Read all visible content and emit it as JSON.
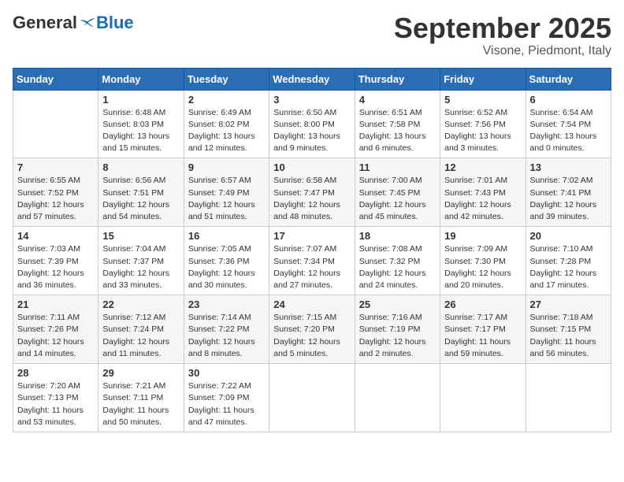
{
  "header": {
    "logo": {
      "general": "General",
      "blue": "Blue"
    },
    "title": "September 2025",
    "location": "Visone, Piedmont, Italy"
  },
  "calendar": {
    "weekdays": [
      "Sunday",
      "Monday",
      "Tuesday",
      "Wednesday",
      "Thursday",
      "Friday",
      "Saturday"
    ],
    "weeks": [
      [
        null,
        {
          "day": 1,
          "sunrise": "6:48 AM",
          "sunset": "8:03 PM",
          "daylight": "13 hours and 15 minutes."
        },
        {
          "day": 2,
          "sunrise": "6:49 AM",
          "sunset": "8:02 PM",
          "daylight": "13 hours and 12 minutes."
        },
        {
          "day": 3,
          "sunrise": "6:50 AM",
          "sunset": "8:00 PM",
          "daylight": "13 hours and 9 minutes."
        },
        {
          "day": 4,
          "sunrise": "6:51 AM",
          "sunset": "7:58 PM",
          "daylight": "13 hours and 6 minutes."
        },
        {
          "day": 5,
          "sunrise": "6:52 AM",
          "sunset": "7:56 PM",
          "daylight": "13 hours and 3 minutes."
        },
        {
          "day": 6,
          "sunrise": "6:54 AM",
          "sunset": "7:54 PM",
          "daylight": "13 hours and 0 minutes."
        }
      ],
      [
        {
          "day": 7,
          "sunrise": "6:55 AM",
          "sunset": "7:52 PM",
          "daylight": "12 hours and 57 minutes."
        },
        {
          "day": 8,
          "sunrise": "6:56 AM",
          "sunset": "7:51 PM",
          "daylight": "12 hours and 54 minutes."
        },
        {
          "day": 9,
          "sunrise": "6:57 AM",
          "sunset": "7:49 PM",
          "daylight": "12 hours and 51 minutes."
        },
        {
          "day": 10,
          "sunrise": "6:58 AM",
          "sunset": "7:47 PM",
          "daylight": "12 hours and 48 minutes."
        },
        {
          "day": 11,
          "sunrise": "7:00 AM",
          "sunset": "7:45 PM",
          "daylight": "12 hours and 45 minutes."
        },
        {
          "day": 12,
          "sunrise": "7:01 AM",
          "sunset": "7:43 PM",
          "daylight": "12 hours and 42 minutes."
        },
        {
          "day": 13,
          "sunrise": "7:02 AM",
          "sunset": "7:41 PM",
          "daylight": "12 hours and 39 minutes."
        }
      ],
      [
        {
          "day": 14,
          "sunrise": "7:03 AM",
          "sunset": "7:39 PM",
          "daylight": "12 hours and 36 minutes."
        },
        {
          "day": 15,
          "sunrise": "7:04 AM",
          "sunset": "7:37 PM",
          "daylight": "12 hours and 33 minutes."
        },
        {
          "day": 16,
          "sunrise": "7:05 AM",
          "sunset": "7:36 PM",
          "daylight": "12 hours and 30 minutes."
        },
        {
          "day": 17,
          "sunrise": "7:07 AM",
          "sunset": "7:34 PM",
          "daylight": "12 hours and 27 minutes."
        },
        {
          "day": 18,
          "sunrise": "7:08 AM",
          "sunset": "7:32 PM",
          "daylight": "12 hours and 24 minutes."
        },
        {
          "day": 19,
          "sunrise": "7:09 AM",
          "sunset": "7:30 PM",
          "daylight": "12 hours and 20 minutes."
        },
        {
          "day": 20,
          "sunrise": "7:10 AM",
          "sunset": "7:28 PM",
          "daylight": "12 hours and 17 minutes."
        }
      ],
      [
        {
          "day": 21,
          "sunrise": "7:11 AM",
          "sunset": "7:26 PM",
          "daylight": "12 hours and 14 minutes."
        },
        {
          "day": 22,
          "sunrise": "7:12 AM",
          "sunset": "7:24 PM",
          "daylight": "12 hours and 11 minutes."
        },
        {
          "day": 23,
          "sunrise": "7:14 AM",
          "sunset": "7:22 PM",
          "daylight": "12 hours and 8 minutes."
        },
        {
          "day": 24,
          "sunrise": "7:15 AM",
          "sunset": "7:20 PM",
          "daylight": "12 hours and 5 minutes."
        },
        {
          "day": 25,
          "sunrise": "7:16 AM",
          "sunset": "7:19 PM",
          "daylight": "12 hours and 2 minutes."
        },
        {
          "day": 26,
          "sunrise": "7:17 AM",
          "sunset": "7:17 PM",
          "daylight": "11 hours and 59 minutes."
        },
        {
          "day": 27,
          "sunrise": "7:18 AM",
          "sunset": "7:15 PM",
          "daylight": "11 hours and 56 minutes."
        }
      ],
      [
        {
          "day": 28,
          "sunrise": "7:20 AM",
          "sunset": "7:13 PM",
          "daylight": "11 hours and 53 minutes."
        },
        {
          "day": 29,
          "sunrise": "7:21 AM",
          "sunset": "7:11 PM",
          "daylight": "11 hours and 50 minutes."
        },
        {
          "day": 30,
          "sunrise": "7:22 AM",
          "sunset": "7:09 PM",
          "daylight": "11 hours and 47 minutes."
        },
        null,
        null,
        null,
        null
      ]
    ]
  }
}
